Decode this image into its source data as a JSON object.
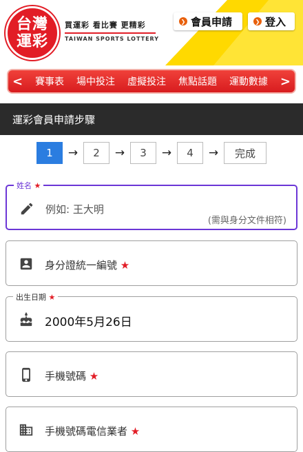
{
  "colors": {
    "brand_red": "#e21d26",
    "brand_yellow": "#ffd900",
    "active_step": "#2b7de0",
    "focus_purple": "#6b35d6",
    "title_bar": "#2b2b2b"
  },
  "header": {
    "logo_line1": "台灣",
    "logo_line2": "運彩",
    "tagline_cn": "買運彩 看比賽 更精彩",
    "tagline_en": "TAIWAN SPORTS LOTTERY",
    "member_apply_label": "會員申請",
    "login_label": "登入"
  },
  "nav": {
    "prev_icon": "chevron-left-icon",
    "next_icon": "chevron-right-icon",
    "items": [
      "賽事表",
      "場中投注",
      "虛擬投注",
      "焦點話題",
      "運動數據"
    ]
  },
  "page_title": "運彩會員申請步驟",
  "steps": {
    "items": [
      "1",
      "2",
      "3",
      "4",
      "完成"
    ],
    "current": 1
  },
  "form": {
    "name": {
      "label": "姓名",
      "required_mark": "★",
      "placeholder": "例如: 王大明",
      "hint": "(需與身分文件相符)",
      "icon": "pencil-icon"
    },
    "id_number": {
      "label": "身分證統一編號",
      "required_mark": "★",
      "icon": "id-card-icon"
    },
    "birth_date": {
      "label": "出生日期",
      "required_mark": "★",
      "value": "2000年5月26日",
      "icon": "cake-icon"
    },
    "phone": {
      "label": "手機號碼",
      "required_mark": "★",
      "icon": "phone-icon"
    },
    "carrier": {
      "label": "手機號碼電信業者",
      "required_mark": "★",
      "icon": "building-icon"
    }
  }
}
